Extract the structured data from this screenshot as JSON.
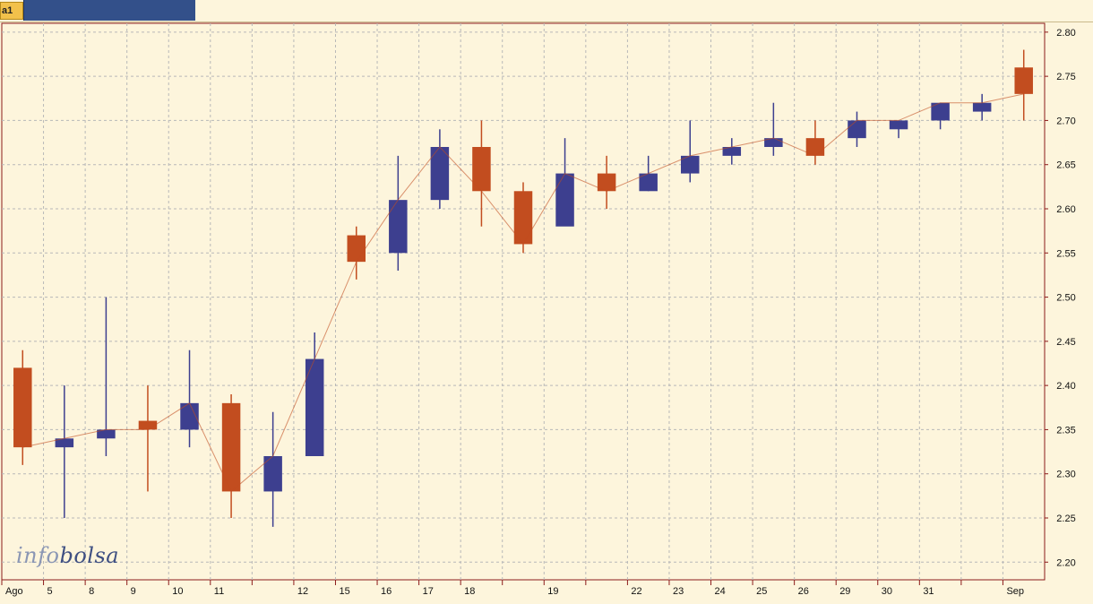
{
  "tabs": [
    {
      "label": "a1",
      "active": true
    }
  ],
  "watermark": {
    "part1": "info",
    "part2": "bolsa"
  },
  "colors": {
    "background": "#fdf5dc",
    "grid": "#b8b8b8",
    "up_bar": "#3d3f8f",
    "down_bar": "#c24d1f",
    "axis": "#8b1a1a"
  },
  "chart_data": {
    "type": "bar",
    "style": "ohlc",
    "title": "",
    "xlabel": "",
    "ylabel": "",
    "ylim": [
      2.18,
      2.81
    ],
    "y_ticks": [
      "2.80",
      "2.75",
      "2.70",
      "2.65",
      "2.60",
      "2.55",
      "2.50",
      "2.45",
      "2.40",
      "2.35",
      "2.30",
      "2.25",
      "2.20"
    ],
    "grid": true,
    "y_axis_side": "right",
    "sessions": [
      {
        "label": "Ago",
        "open": 2.42,
        "close": 2.33,
        "high": 2.44,
        "low": 2.31
      },
      {
        "label": "5",
        "open": 2.33,
        "close": 2.34,
        "high": 2.4,
        "low": 2.25
      },
      {
        "label": "8",
        "open": 2.34,
        "close": 2.35,
        "high": 2.5,
        "low": 2.32
      },
      {
        "label": "9",
        "open": 2.36,
        "close": 2.35,
        "high": 2.4,
        "low": 2.28
      },
      {
        "label": "10",
        "open": 2.35,
        "close": 2.38,
        "high": 2.44,
        "low": 2.33
      },
      {
        "label": "11",
        "open": 2.38,
        "close": 2.28,
        "high": 2.39,
        "low": 2.25
      },
      {
        "label": "",
        "open": 2.28,
        "close": 2.32,
        "high": 2.37,
        "low": 2.24
      },
      {
        "label": "12",
        "open": 2.32,
        "close": 2.43,
        "high": 2.46,
        "low": 2.33
      },
      {
        "label": "15",
        "open": 2.57,
        "close": 2.54,
        "high": 2.58,
        "low": 2.52
      },
      {
        "label": "16",
        "open": 2.55,
        "close": 2.61,
        "high": 2.66,
        "low": 2.53
      },
      {
        "label": "17",
        "open": 2.61,
        "close": 2.67,
        "high": 2.69,
        "low": 2.6
      },
      {
        "label": "18",
        "open": 2.67,
        "close": 2.62,
        "high": 2.7,
        "low": 2.58
      },
      {
        "label": "",
        "open": 2.62,
        "close": 2.56,
        "high": 2.63,
        "low": 2.55
      },
      {
        "label": "19",
        "open": 2.58,
        "close": 2.64,
        "high": 2.68,
        "low": 2.59
      },
      {
        "label": "",
        "open": 2.64,
        "close": 2.62,
        "high": 2.66,
        "low": 2.6
      },
      {
        "label": "22",
        "open": 2.62,
        "close": 2.64,
        "high": 2.66,
        "low": 2.62
      },
      {
        "label": "23",
        "open": 2.64,
        "close": 2.66,
        "high": 2.7,
        "low": 2.63
      },
      {
        "label": "24",
        "open": 2.66,
        "close": 2.67,
        "high": 2.68,
        "low": 2.65
      },
      {
        "label": "25",
        "open": 2.67,
        "close": 2.68,
        "high": 2.72,
        "low": 2.66
      },
      {
        "label": "26",
        "open": 2.68,
        "close": 2.66,
        "high": 2.7,
        "low": 2.65
      },
      {
        "label": "29",
        "open": 2.68,
        "close": 2.7,
        "high": 2.71,
        "low": 2.67
      },
      {
        "label": "30",
        "open": 2.69,
        "close": 2.7,
        "high": 2.7,
        "low": 2.68
      },
      {
        "label": "31",
        "open": 2.7,
        "close": 2.72,
        "high": 2.72,
        "low": 2.69
      },
      {
        "label": "",
        "open": 2.71,
        "close": 2.72,
        "high": 2.73,
        "low": 2.7
      },
      {
        "label": "Sep",
        "open": 2.76,
        "close": 2.73,
        "high": 2.78,
        "low": 2.7
      }
    ]
  }
}
